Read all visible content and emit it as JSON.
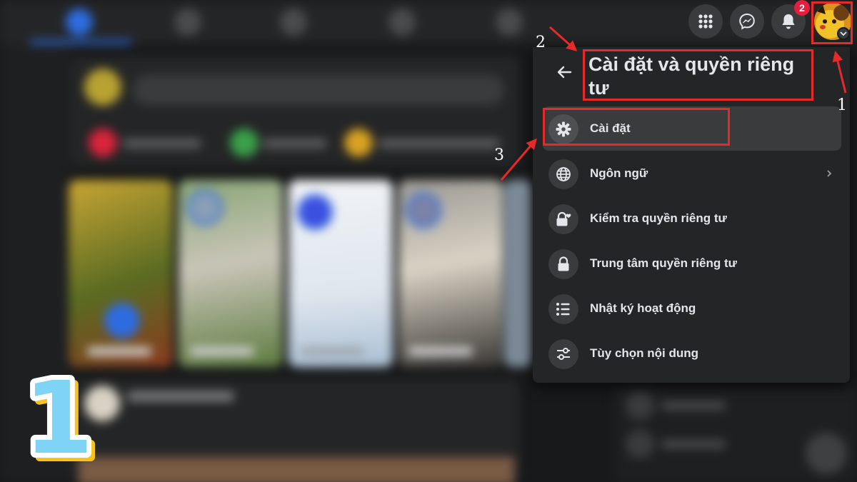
{
  "notifications": {
    "badge_count": "2"
  },
  "panel": {
    "title": "Cài đặt và quyền riêng tư",
    "items": [
      {
        "label": "Cài đặt",
        "icon": "gear-icon",
        "highlighted": true
      },
      {
        "label": "Ngôn ngữ",
        "icon": "globe-icon",
        "has_chevron": true
      },
      {
        "label": "Kiểm tra quyền riêng tư",
        "icon": "lock-heart-icon"
      },
      {
        "label": "Trung tâm quyền riêng tư",
        "icon": "lock-icon"
      },
      {
        "label": "Nhật ký hoạt động",
        "icon": "list-icon"
      },
      {
        "label": "Tùy chọn nội dung",
        "icon": "sliders-icon"
      }
    ]
  },
  "annotations": {
    "step_1": "1",
    "step_2": "2",
    "step_3": "3",
    "step_badge": "1",
    "color": "#e62a2a"
  },
  "colors": {
    "panel_bg": "#242526",
    "accent_blue": "#2d6cdf",
    "badge_red": "#e41e3f",
    "text_primary": "#e4e6eb"
  }
}
